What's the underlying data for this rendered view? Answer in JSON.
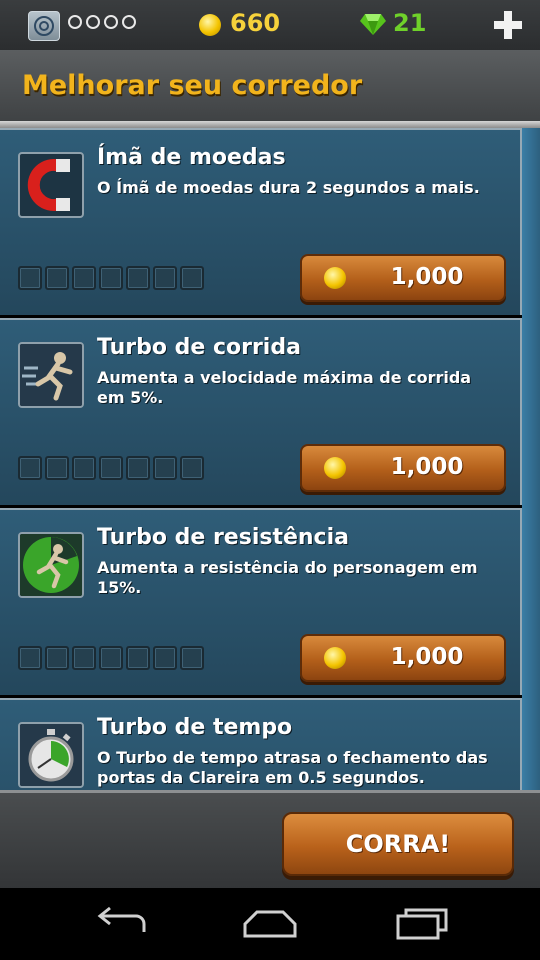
{
  "topbar": {
    "progress_dots": 4,
    "coins": "660",
    "gems": "21"
  },
  "page_title": "Melhorar seu corredor",
  "upgrades": [
    {
      "title": "Ímã de moedas",
      "description": "O Ímã de moedas dura 2 segundos a mais.",
      "icon": "magnet-icon",
      "level": 0,
      "max_level": 7,
      "price": "1,000"
    },
    {
      "title": "Turbo de corrida",
      "description": "Aumenta a velocidade máxima de corrida em 5%.",
      "icon": "sprinter-icon",
      "level": 0,
      "max_level": 7,
      "price": "1,000"
    },
    {
      "title": "Turbo de resistência",
      "description": "Aumenta a resistência do personagem em 15%.",
      "icon": "stamina-runner-icon",
      "level": 0,
      "max_level": 7,
      "price": "1,000"
    },
    {
      "title": "Turbo de tempo",
      "description": "O Turbo de tempo atrasa o fechamento das portas da Clareira em 0.5 segundos.",
      "icon": "stopwatch-icon",
      "level": 0,
      "max_level": 7,
      "price": ""
    }
  ],
  "run_button": "CORRA!",
  "colors": {
    "title_gold": "#f2b41c",
    "coin_yellow": "#f6d23b",
    "gem_green": "#6fd12a",
    "card_blue": "#2f5d78",
    "button_orange": "#b9621b"
  }
}
